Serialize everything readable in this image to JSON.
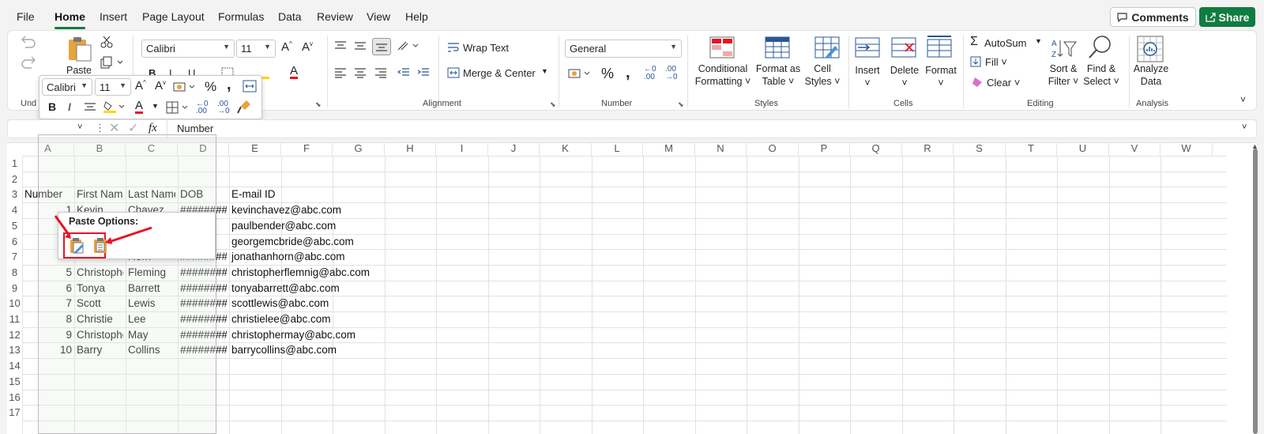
{
  "menu": {
    "items": [
      "File",
      "Home",
      "Insert",
      "Page Layout",
      "Formulas",
      "Data",
      "Review",
      "View",
      "Help"
    ],
    "active": "Home",
    "comments": "Comments",
    "share": "Share"
  },
  "ribbon": {
    "clipboard": {
      "paste": "Paste",
      "label": "Und"
    },
    "font": {
      "name": "Calibri",
      "size": "11"
    },
    "alignment": {
      "wrap": "Wrap Text",
      "merge": "Merge & Center",
      "label": "Alignment"
    },
    "number": {
      "format": "General",
      "label": "Number"
    },
    "styles": {
      "cond1": "Conditional",
      "cond2": "Formatting",
      "fmt1": "Format as",
      "fmt2": "Table",
      "cell1": "Cell",
      "cell2": "Styles",
      "label": "Styles"
    },
    "cells": {
      "insert": "Insert",
      "delete": "Delete",
      "format": "Format",
      "label": "Cells"
    },
    "editing": {
      "autosum": "AutoSum",
      "fill": "Fill",
      "clear": "Clear",
      "sort1": "Sort &",
      "sort2": "Filter",
      "find1": "Find &",
      "find2": "Select",
      "label": "Editing"
    },
    "analysis": {
      "a1": "Analyze",
      "a2": "Data",
      "label": "Analysis"
    }
  },
  "formula": {
    "content": "Number",
    "fx": "fx"
  },
  "mini_toolbar": {
    "font": "Calibri",
    "size": "11"
  },
  "paste_options": {
    "title": "Paste Options:"
  },
  "columns": [
    "A",
    "B",
    "C",
    "D",
    "E",
    "F",
    "G",
    "H",
    "I",
    "J",
    "K",
    "L",
    "M",
    "N",
    "O",
    "P",
    "Q",
    "R",
    "S",
    "T",
    "U",
    "V",
    "W"
  ],
  "rows": [
    "1",
    "2",
    "3",
    "4",
    "5",
    "6",
    "7",
    "8",
    "9",
    "10",
    "11",
    "12",
    "13",
    "14",
    "15",
    "16",
    "17"
  ],
  "sheet": {
    "headers": [
      "Number",
      "First Name",
      "Last Name",
      "DOB",
      "E-mail ID"
    ],
    "visible_partial_row4": {
      "first": "Kevin",
      "last": "Chavez"
    },
    "partial_row7_last": "Horn",
    "data": [
      {
        "num": "1",
        "first": "",
        "last": "",
        "dob": "########",
        "email": "kevinchavez@abc.com"
      },
      {
        "num": "",
        "first": "",
        "last": "",
        "dob": "#",
        "email": "paulbender@abc.com"
      },
      {
        "num": "",
        "first": "",
        "last": "",
        "dob": "#",
        "email": "georgemcbride@abc.com"
      },
      {
        "num": "",
        "first": "",
        "last": "Horn",
        "dob": "########",
        "email": "jonathanhorn@abc.com"
      },
      {
        "num": "5",
        "first": "Christophe",
        "last": "Fleming",
        "dob": "########",
        "email": "christopherflemnig@abc.com"
      },
      {
        "num": "6",
        "first": "Tonya",
        "last": "Barrett",
        "dob": "########",
        "email": "tonyabarrett@abc.com"
      },
      {
        "num": "7",
        "first": "Scott",
        "last": "Lewis",
        "dob": "########",
        "email": "scottlewis@abc.com"
      },
      {
        "num": "8",
        "first": "Christie",
        "last": "Lee",
        "dob": "########",
        "email": "christielee@abc.com"
      },
      {
        "num": "9",
        "first": "Christophe",
        "last": "May",
        "dob": "########",
        "email": "christophermay@abc.com"
      },
      {
        "num": "10",
        "first": "Barry",
        "last": "Collins",
        "dob": "########",
        "email": "barrycollins@abc.com"
      }
    ]
  },
  "colors": {
    "accent": "#107c41",
    "annotation": "#e81123"
  }
}
